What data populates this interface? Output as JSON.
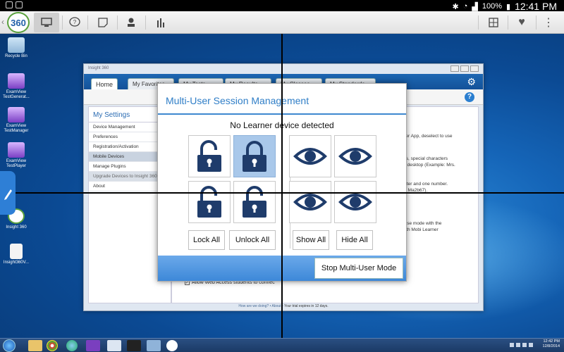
{
  "status_bar": {
    "battery": "100%",
    "time": "12:41 PM"
  },
  "toolbar": {
    "logo": "360",
    "icons": [
      "back-chevron-icon",
      "monitor-icon",
      "question-bubble-icon",
      "window-icon",
      "user-icon",
      "bar-chart-icon",
      "grid-icon",
      "heart-icon",
      "more-icon"
    ]
  },
  "desktop": {
    "icons": [
      {
        "label": "Recycle Bin"
      },
      {
        "label": "ExamView TestGenerat..."
      },
      {
        "label": "ExamView TestManager"
      },
      {
        "label": "ExamView TestPlayer"
      },
      {
        "label": "Insight 360"
      },
      {
        "label": "Insight360V..."
      }
    ]
  },
  "window": {
    "title": "Insight 360",
    "tabs": [
      "Home",
      "My Favorites",
      "My Tests",
      "My Results",
      "My Classes",
      "My Standards"
    ],
    "sidebar_title": "My Settings",
    "sidebar_items": [
      "Device Management",
      "Preferences",
      "Registration/Activation",
      "Mobile Devices",
      "Manage Plugins",
      "Upgrade Devices to Insight 360",
      "About"
    ],
    "main_text": [
      "ther App, deselect to use",
      "ers, special characters",
      "ur desktop (Example: Mrs.",
      "letter and one number.",
      "le: Ma2b67).",
      "onse mode with the",
      "with Mobi Learner"
    ],
    "checkbox_label": "Allow Web Access students to connec",
    "footer_link1": "How are we doing?",
    "footer_link2": "About",
    "footer_trial": "Your trial expires in 12 days."
  },
  "modal": {
    "title": "Multi-User Session Management",
    "status": "No Learner device detected",
    "lock_all": "Lock All",
    "unlock_all": "Unlock All",
    "show_all": "Show All",
    "hide_all": "Hide All",
    "stop": "Stop Multi-User Mode"
  },
  "taskbar": {
    "time": "12:42 PM",
    "date": "12/8/2014"
  },
  "colors": {
    "accent": "#3e88cf",
    "icon_navy": "#1f3c6b",
    "selected_tile": "#a9c8ea"
  }
}
